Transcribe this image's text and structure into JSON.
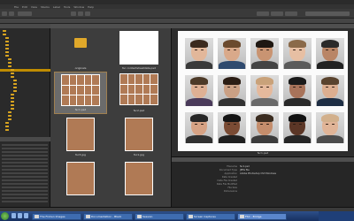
{
  "window": {
    "title": ""
  },
  "menu": {
    "items": [
      "File",
      "Edit",
      "View",
      "Stacks",
      "Label",
      "Tools",
      "Window",
      "Help"
    ]
  },
  "content_panel": {
    "items": [
      {
        "label": "originals",
        "kind": "folder"
      },
      {
        "label": "fsc contactsheetdata.psd",
        "kind": "blank"
      },
      {
        "label": "fsc1.psd",
        "kind": "sheet",
        "selected": true
      },
      {
        "label": "fsc2.psd",
        "kind": "sheet"
      },
      {
        "label": "fsc3.jpg",
        "kind": "sheet"
      },
      {
        "label": "fsc1.jpg",
        "kind": "sheet"
      },
      {
        "label": "",
        "kind": "sheet"
      },
      {
        "label": "",
        "kind": "sheet"
      }
    ]
  },
  "preview": {
    "label": "fsc1.psd",
    "faces": 15
  },
  "metadata": {
    "rows": [
      {
        "key": "Filename",
        "value": "fsc1.psd"
      },
      {
        "key": "Document Type",
        "value": "JPEG file"
      },
      {
        "key": "Application",
        "value": "Adobe Photoshop CS3 Windows"
      },
      {
        "key": "Date Created",
        "value": ""
      },
      {
        "key": "Date File Created",
        "value": ""
      },
      {
        "key": "Date File Modified",
        "value": ""
      },
      {
        "key": "File Size",
        "value": ""
      },
      {
        "key": "Dimensions",
        "value": ""
      }
    ]
  },
  "taskbar": {
    "tasks": [
      "The FinCen Images",
      "Documentation - Black",
      "Session",
      "Screen Captures",
      "FSC - Bridge"
    ],
    "clock": "",
    "colors": {
      "bar": "#173060",
      "task": "#3e6cb0"
    }
  },
  "colors": {
    "accent": "#d9a520",
    "panel": "#3d3d3d",
    "selection": "#a08050"
  }
}
